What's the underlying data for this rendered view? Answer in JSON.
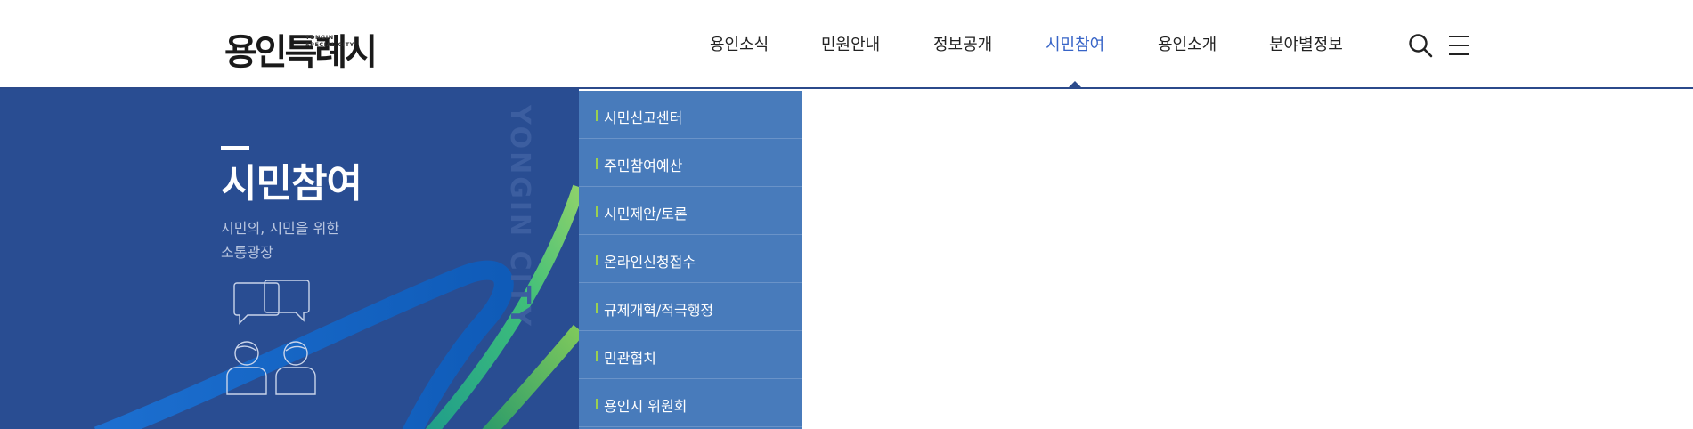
{
  "header": {
    "logo": {
      "main": "용인특례시",
      "sub_line1": "YONGIN",
      "sub_line2": "SPECIAL CITY"
    },
    "nav": [
      {
        "label": "용인소식"
      },
      {
        "label": "민원안내"
      },
      {
        "label": "정보공개"
      },
      {
        "label": "시민참여",
        "active": true
      },
      {
        "label": "용인소개"
      },
      {
        "label": "분야별정보"
      }
    ],
    "icons": {
      "search": "search-icon",
      "menu": "hamburger-menu-icon"
    }
  },
  "hero": {
    "title": "시민참여",
    "subtitle_line1": "시민의, 시민을 위한",
    "subtitle_line2": "소통광장",
    "watermark": "YONGIN CITY",
    "illustration": "people-chat-icon"
  },
  "submenu": {
    "items": [
      {
        "label": "시민신고센터"
      },
      {
        "label": "주민참여예산"
      },
      {
        "label": "시민제안/토론"
      },
      {
        "label": "온라인신청접수"
      },
      {
        "label": "규제개혁/적극행정"
      },
      {
        "label": "민관협치"
      },
      {
        "label": "용인시 위원회"
      }
    ]
  },
  "colors": {
    "hero_bg": "#294d92",
    "submenu_bg": "#487bbb",
    "active_nav": "#3764c7",
    "bullet": "#9bd04f",
    "header_border": "#2b4a8b"
  }
}
